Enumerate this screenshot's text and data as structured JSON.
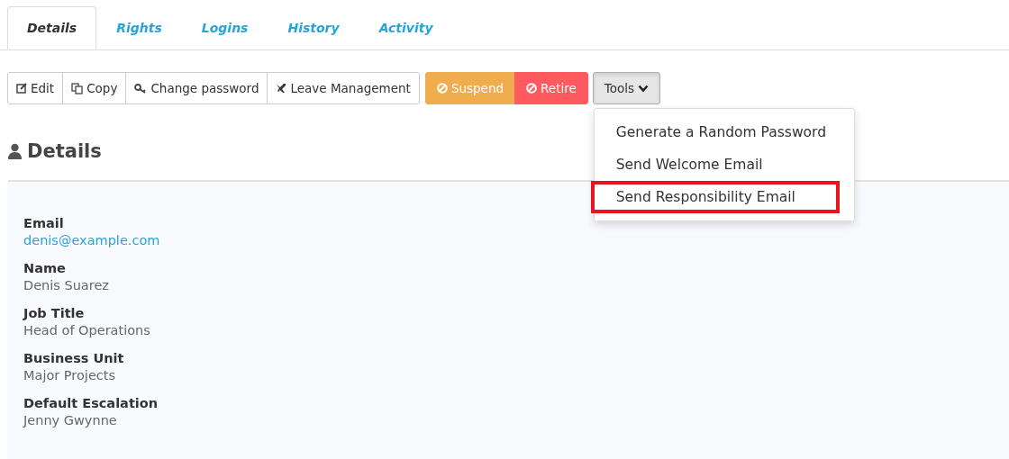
{
  "tabs": [
    {
      "label": "Details",
      "selected": true
    },
    {
      "label": "Rights",
      "selected": false
    },
    {
      "label": "Logins",
      "selected": false
    },
    {
      "label": "History",
      "selected": false
    },
    {
      "label": "Activity",
      "selected": false
    }
  ],
  "toolbar": [
    {
      "label": "Edit",
      "kind": "default"
    },
    {
      "label": "Copy",
      "kind": "default"
    },
    {
      "label": "Change password",
      "kind": "default"
    },
    {
      "label": "Leave Management",
      "kind": "default"
    },
    {
      "label": "Suspend",
      "kind": "warning"
    },
    {
      "label": "Retire",
      "kind": "danger"
    },
    {
      "label": "Tools",
      "kind": "dropdown",
      "expanded": true
    }
  ],
  "tools_menu": [
    {
      "label": "Generate a Random Password",
      "highlighted": false
    },
    {
      "label": "Send Welcome Email",
      "highlighted": false
    },
    {
      "label": "Send Responsibility Email",
      "highlighted": true
    }
  ],
  "section_title": "Details",
  "fields": [
    {
      "label": "Email",
      "value": "denis@example.com",
      "kind": "link"
    },
    {
      "label": "Name",
      "value": "Denis Suarez",
      "kind": "text"
    },
    {
      "label": "Job Title",
      "value": "Head of Operations",
      "kind": "text"
    },
    {
      "label": "Business Unit",
      "value": "Major Projects",
      "kind": "text"
    },
    {
      "label": "Default Escalation",
      "value": "Jenny Gwynne",
      "kind": "text"
    }
  ]
}
